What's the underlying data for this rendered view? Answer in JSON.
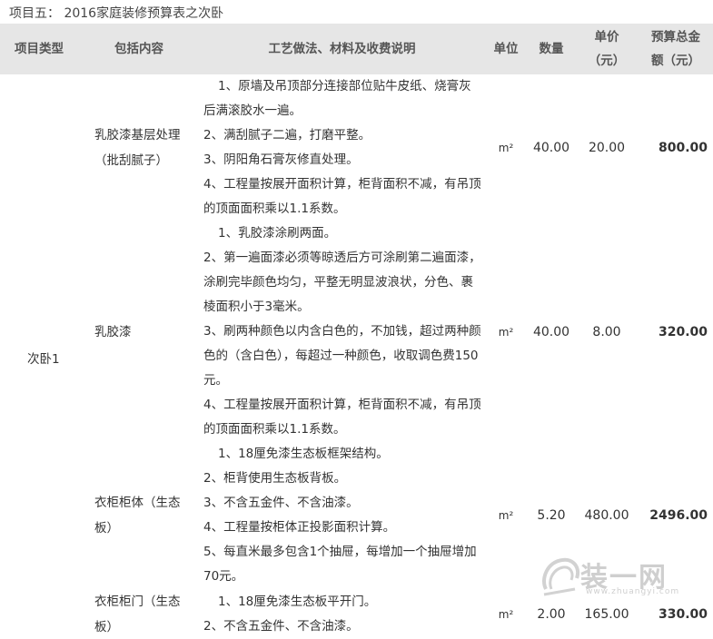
{
  "caption": "项目五： 2016家庭装修预算表之次卧",
  "headers": {
    "type": "项目类型",
    "includes": "包括内容",
    "desc": "工艺做法、材料及收费说明",
    "unit": "单位",
    "qty": "数量",
    "price_line1": "单价",
    "price_line2": "（元）",
    "total_line1": "预算总金",
    "total_line2": "额（元）"
  },
  "room": "次卧1",
  "rows": [
    {
      "include_lines": [
        "乳胶漆基层处理",
        "（批刮腻子）"
      ],
      "desc": [
        "1、原墙及吊顶部分连接部位贴牛皮纸、烧膏灰后满滚胶水一遍。",
        "2、满刮腻子二遍，打磨平整。",
        "3、阴阳角石膏灰修直处理。",
        "4、工程量按展开面积计算，柜背面积不减，有吊顶的顶面面积乘以1.1系数。"
      ],
      "unit": "m²",
      "qty": "40.00",
      "price": "20.00",
      "total": "800.00"
    },
    {
      "include_lines": [
        "乳胶漆"
      ],
      "desc": [
        "1、乳胶漆涂刷两面。",
        "2、第一遍面漆必须等晾透后方可涂刷第二遍面漆， 涂刷完毕颜色均匀，平整无明显波浪状，分色、裹棱面积小于3毫米。",
        "3、刷两种颜色以内含白色的，不加钱，超过两种颜色的（含白色），每超过一种颜色，收取调色费150元。",
        "4、工程量按展开面积计算，柜背面积不减，有吊顶的顶面面积乘以1.1系数。"
      ],
      "unit": "m²",
      "qty": "40.00",
      "price": "8.00",
      "total": "320.00"
    },
    {
      "include_lines": [
        "衣柜柜体（生态",
        "板）"
      ],
      "desc": [
        "1、18厘免漆生态板框架结构。",
        "2、柜背使用生态板背板。",
        "3、不含五金件、不含油漆。",
        "4、工程量按柜体正投影面积计算。",
        "5、每直米最多包含1个抽屉，每增加一个抽屉增加70元。"
      ],
      "unit": "m²",
      "qty": "5.20",
      "price": "480.00",
      "total": "2496.00"
    },
    {
      "include_lines": [
        "衣柜柜门（生态",
        "板）"
      ],
      "desc": [
        "1、18厘免漆生态板平开门。",
        "2、不含五金件、不含油漆。"
      ],
      "unit": "m²",
      "qty": "2.00",
      "price": "165.00",
      "total": "330.00"
    }
  ],
  "watermark": {
    "text": "装一网",
    "sub": "www.zhuangyi.com",
    "icon": "zhuangyi-logo-icon"
  }
}
